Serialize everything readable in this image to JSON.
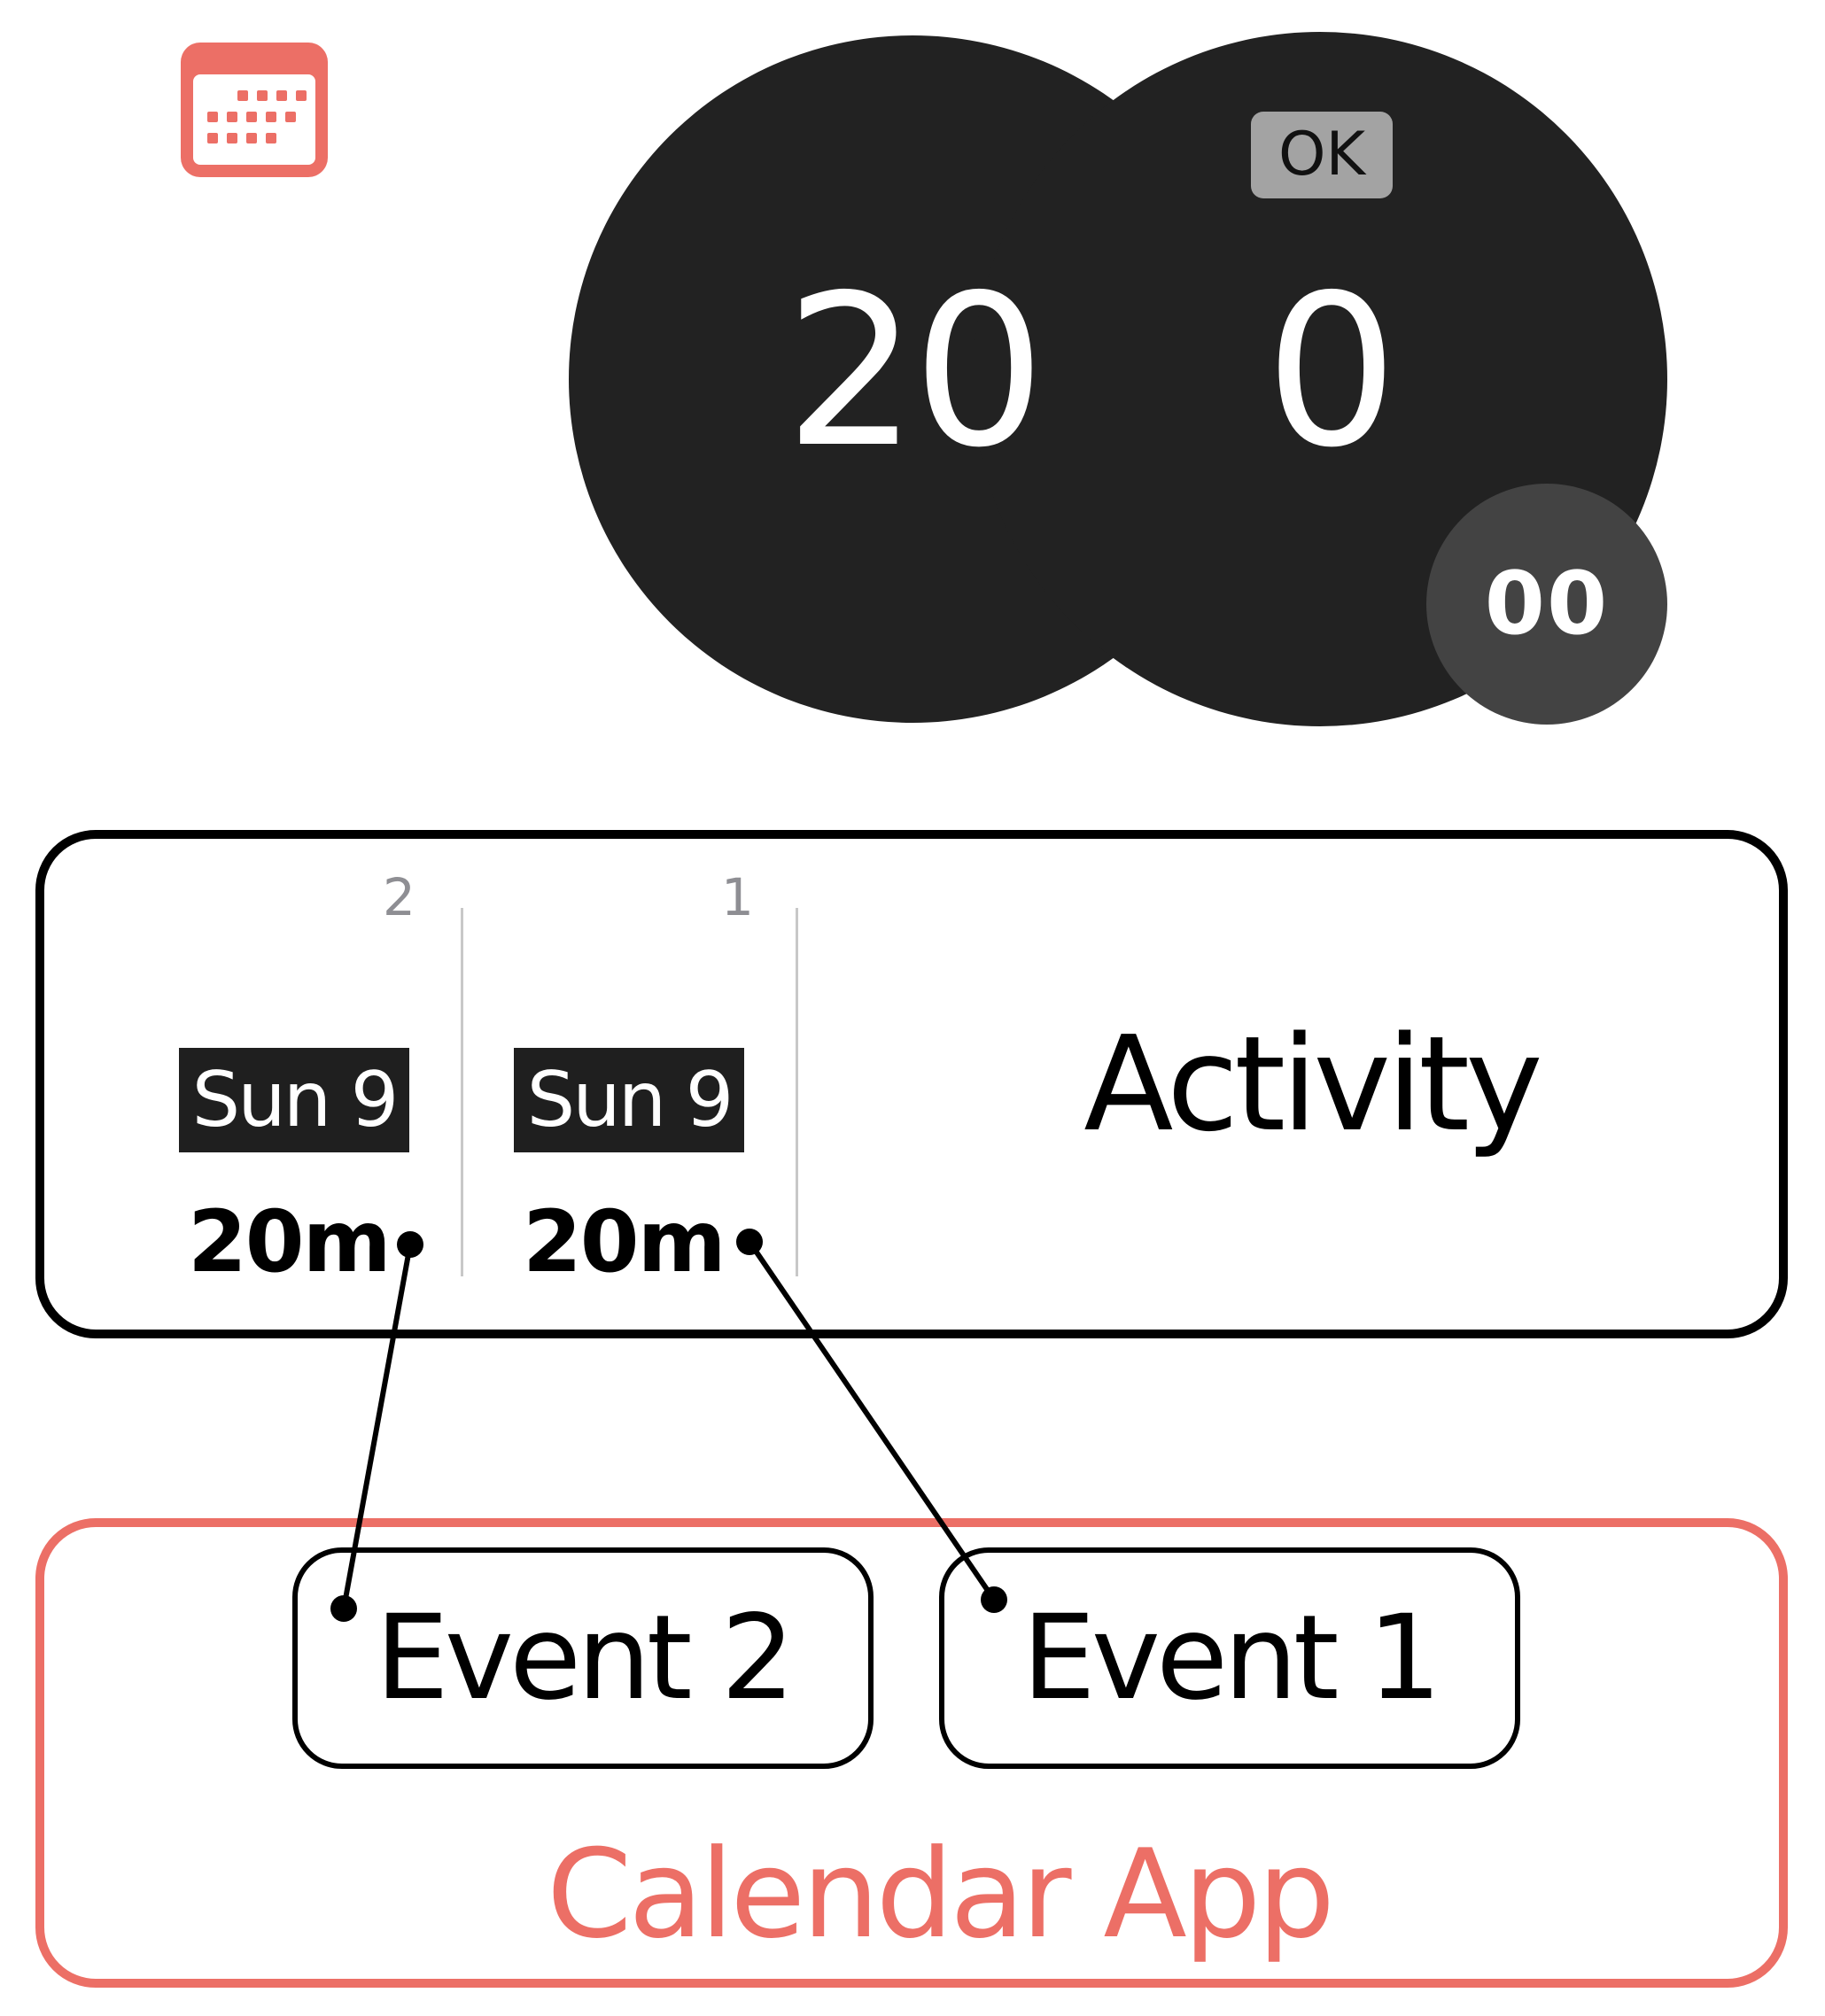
{
  "icons": {
    "app_icon": "calendar-icon",
    "app_icon_color": "#ec6f66"
  },
  "timer": {
    "hours": "20",
    "minutes": "0",
    "seconds": "00",
    "ok_label": "OK"
  },
  "activity": {
    "title": "Activity",
    "columns": [
      {
        "index": "2",
        "date": "Sun 9",
        "duration": "20m"
      },
      {
        "index": "1",
        "date": "Sun 9",
        "duration": "20m"
      }
    ]
  },
  "calendar": {
    "label": "Calendar App",
    "accent": "#ec6f66",
    "events": [
      {
        "label": "Event 2"
      },
      {
        "label": "Event 1"
      }
    ]
  }
}
